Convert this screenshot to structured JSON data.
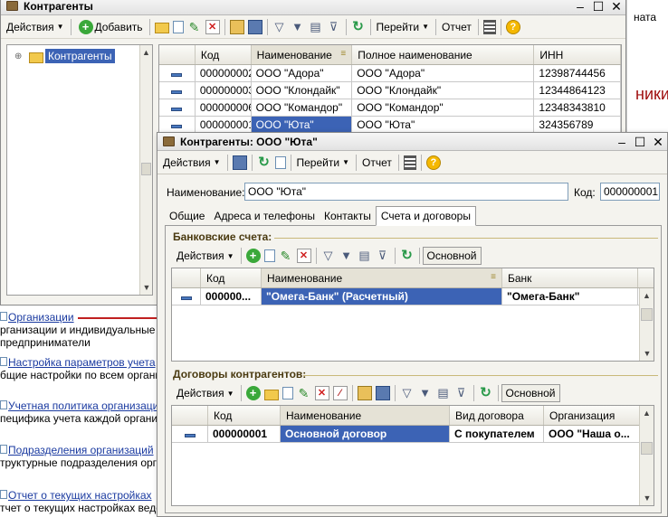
{
  "bg": {
    "right_text1": "ната",
    "right_text2": "ники"
  },
  "main_window": {
    "title": "Контрагенты",
    "toolbar": {
      "actions": "Действия",
      "add": "Добавить",
      "goto": "Перейти",
      "report": "Отчет"
    },
    "tree": {
      "root": "Контрагенты"
    },
    "grid": {
      "headers": [
        "Код",
        "Наименование",
        "Полное наименование",
        "ИНН"
      ],
      "rows": [
        [
          "000000002",
          "ООО \"Адора\"",
          "ООО \"Адора\"",
          "12398744456"
        ],
        [
          "000000003",
          "ООО \"Клондайк\"",
          "ООО \"Клондайк\"",
          "12344864123"
        ],
        [
          "000000006",
          "ООО \"Командор\"",
          "ООО \"Командор\"",
          "12348343810"
        ],
        [
          "000000001",
          "ООО \"Юта\"",
          "ООО \"Юта\"",
          "324356789"
        ]
      ]
    }
  },
  "side_links": [
    {
      "link": "Организации",
      "desc": "рганизации и индивидуальные предприниматели"
    },
    {
      "link": "Настройка параметров учета",
      "desc": "бщие настройки по всем организ"
    },
    {
      "link": "Учетная политика организаций",
      "desc": "пецифика учета каждой организа"
    },
    {
      "link": "Подразделения организаций",
      "desc": "труктурные подразделения орган"
    },
    {
      "link": "Отчет о текущих настройках",
      "desc": "тчет о текущих настройках веден"
    }
  ],
  "dialog": {
    "title": "Контрагенты: ООО \"Юта\"",
    "toolbar": {
      "actions": "Действия",
      "goto": "Перейти",
      "report": "Отчет"
    },
    "name_label": "Наименование:",
    "name_value": "ООО \"Юта\"",
    "code_label": "Код:",
    "code_value": "000000001",
    "tabs": [
      "Общие",
      "Адреса и телефоны",
      "Контакты",
      "Счета и договоры"
    ],
    "bank": {
      "title": "Банковские счета:",
      "actions": "Действия",
      "main_btn": "Основной",
      "headers": [
        "Код",
        "Наименование",
        "Банк"
      ],
      "row": [
        "000000...",
        "\"Омега-Банк\" (Расчетный)",
        "\"Омега-Банк\""
      ]
    },
    "contracts": {
      "title": "Договоры контрагентов:",
      "actions": "Действия",
      "main_btn": "Основной",
      "headers": [
        "Код",
        "Наименование",
        "Вид договора",
        "Организация"
      ],
      "row": [
        "000000001",
        "Основной договор",
        "С покупателем",
        "ООО \"Наша о..."
      ]
    }
  }
}
